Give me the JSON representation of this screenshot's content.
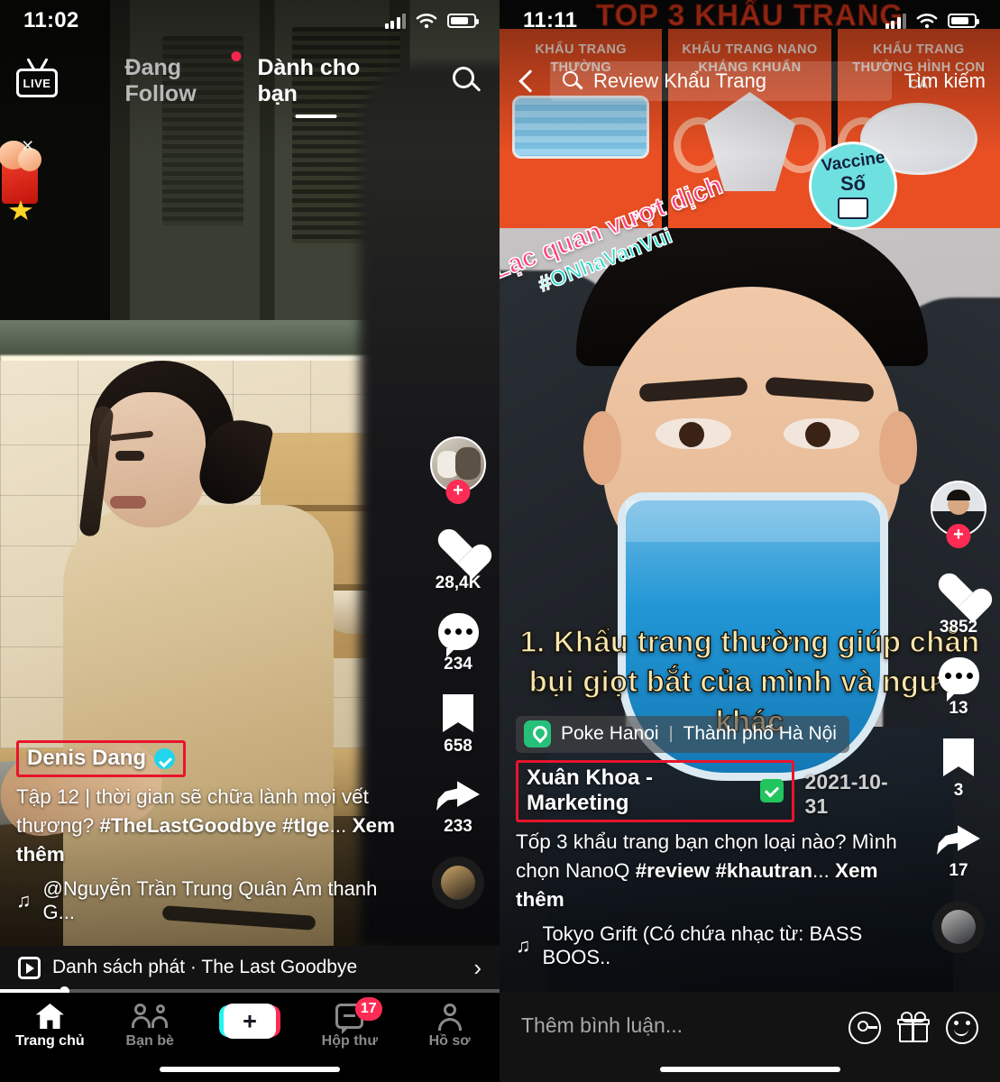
{
  "left_phone": {
    "status_bar": {
      "time": "11:02",
      "battery_icon": "battery-icon",
      "wifi_icon": "wifi-icon",
      "signal_icon": "signal-icon"
    },
    "top_nav": {
      "live_label": "LIVE",
      "tabs": [
        {
          "label": "Đang Follow",
          "active": false,
          "has_dot": true
        },
        {
          "label": "Dành cho bạn",
          "active": true,
          "has_dot": false
        }
      ],
      "search_icon": "search-icon"
    },
    "close_button": "×",
    "rail": {
      "avatar_plus": "+",
      "actions": [
        {
          "icon": "heart-icon",
          "count": "28,4K"
        },
        {
          "icon": "comment-icon",
          "count": "234"
        },
        {
          "icon": "bookmark-icon",
          "count": "658"
        },
        {
          "icon": "share-icon",
          "count": "233"
        }
      ]
    },
    "caption": {
      "username": "Denis Dang",
      "verified": true,
      "text_part1": "Tập 12 | thời gian sẽ chữa lành mọi vết thương? ",
      "hashtags": "#TheLastGoodbye #tlge",
      "ellipsis": "... ",
      "see_more": "Xem thêm",
      "music_icon": "music-note-icon",
      "music": "@Nguyễn Trần Trung Quân Âm thanh G..."
    },
    "playlist": {
      "icon": "playlist-icon",
      "label": "Danh sách phát · The Last Goodbye",
      "chevron": "›"
    },
    "progress_percent": 12,
    "bottom_nav": [
      {
        "label": "Trang chủ",
        "icon": "home-icon",
        "active": true,
        "badge": null
      },
      {
        "label": "Bạn bè",
        "icon": "friends-icon",
        "active": false,
        "badge": null
      },
      {
        "label": "",
        "icon": "create-icon",
        "active": false,
        "badge": null,
        "plus": "+"
      },
      {
        "label": "Hộp thư",
        "icon": "inbox-icon",
        "active": false,
        "badge": "17"
      },
      {
        "label": "Hồ sơ",
        "icon": "profile-icon",
        "active": false,
        "badge": null
      }
    ]
  },
  "right_phone": {
    "status_bar": {
      "time": "11:11",
      "battery_icon": "battery-icon",
      "wifi_icon": "wifi-icon",
      "signal_icon": "signal-icon"
    },
    "top_bar": {
      "back_icon": "back-chevron-icon",
      "search_icon": "search-icon",
      "search_value": "Review Khẩu Trang",
      "search_button": "Tìm kiếm"
    },
    "video_banner": {
      "title": "TOP 3 KHẨU TRANG",
      "cells": [
        {
          "label": "KHẨU TRANG THƯỜNG",
          "mask": "surgical-mask"
        },
        {
          "label": "KHẨU TRANG NANO KHÁNG KHUẨN",
          "mask": "n95-mask"
        },
        {
          "label": "KHẨU TRANG THƯỜNG HÌNH CON CÁ",
          "mask": "fish-mask"
        }
      ]
    },
    "sticker": {
      "line1": "Lạc quan vượt dịch",
      "line2": "#ONhaVanVui",
      "heart": "♥"
    },
    "vaccine_badge": {
      "line1": "Vaccine",
      "line2": "Số"
    },
    "video_text": "1. Khẩu trang thường giúp chắn bụi giọt bắt của mình và người khác",
    "rail": {
      "avatar_plus": "+",
      "actions": [
        {
          "icon": "heart-icon",
          "count": "3852"
        },
        {
          "icon": "comment-icon",
          "count": "13"
        },
        {
          "icon": "bookmark-icon",
          "count": "3"
        },
        {
          "icon": "share-icon",
          "count": "17"
        }
      ]
    },
    "location": {
      "icon": "location-pin-icon",
      "place": "Poke Hanoi",
      "separator": "|",
      "city": "Thành phố Hà Nội"
    },
    "caption": {
      "username": "Xuân Khoa - Marketing",
      "verified_emoji": "green-check-icon",
      "date": "2021-10-31",
      "text_part1": "Tốp 3 khẩu trang bạn chọn loại nào? Mình chọn NanoQ ",
      "hashtags": "#review #khautran",
      "ellipsis": "... ",
      "see_more": "Xem thêm",
      "music_icon": "music-note-icon",
      "music": "Tokyo Grift (Có chứa nhạc từ: BASS BOOS.."
    },
    "comment_bar": {
      "placeholder": "Thêm bình luận...",
      "icons": [
        "at-icon",
        "gift-icon",
        "emoji-icon"
      ]
    }
  },
  "colors": {
    "accent_pink": "#fe2c55",
    "accent_cyan": "#25f4ee",
    "highlight_red": "#e8142d",
    "verified_blue": "#20d5ec",
    "green_check": "#21c45d"
  }
}
